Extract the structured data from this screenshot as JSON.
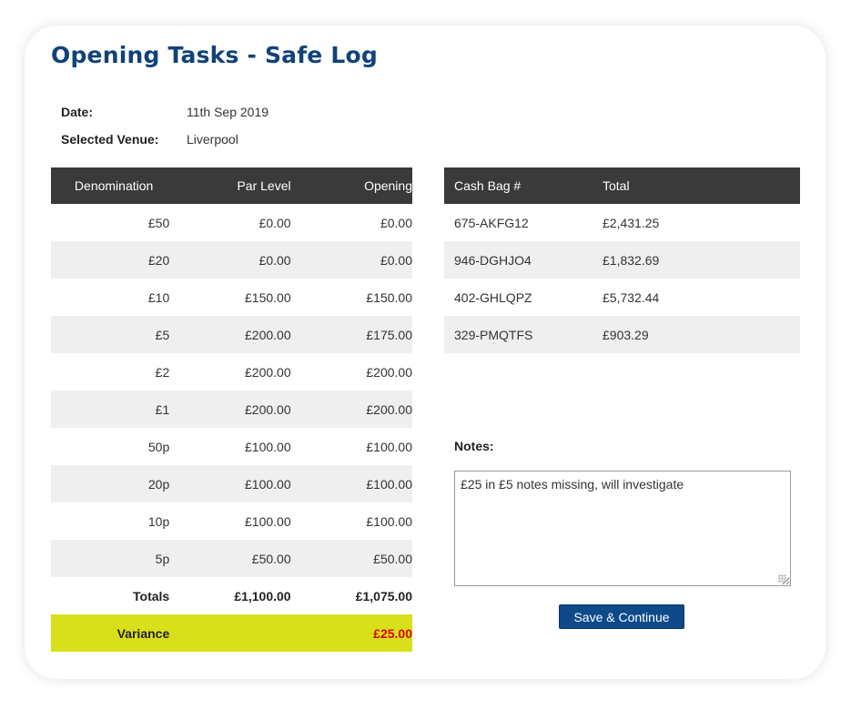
{
  "page": {
    "title": "Opening Tasks - Safe Log"
  },
  "meta": {
    "date_label": "Date:",
    "date_value": "11th Sep 2019",
    "venue_label": "Selected Venue:",
    "venue_value": "Liverpool"
  },
  "denominations": {
    "headers": [
      "Denomination",
      "Par Level",
      "Opening"
    ],
    "rows": [
      [
        "£50",
        "£0.00",
        "£0.00"
      ],
      [
        "£20",
        "£0.00",
        "£0.00"
      ],
      [
        "£10",
        "£150.00",
        "£150.00"
      ],
      [
        "£5",
        "£200.00",
        "£175.00"
      ],
      [
        "£2",
        "£200.00",
        "£200.00"
      ],
      [
        "£1",
        "£200.00",
        "£200.00"
      ],
      [
        "50p",
        "£100.00",
        "£100.00"
      ],
      [
        "20p",
        "£100.00",
        "£100.00"
      ],
      [
        "10p",
        "£100.00",
        "£100.00"
      ],
      [
        "5p",
        "£50.00",
        "£50.00"
      ]
    ],
    "totals": [
      "Totals",
      "£1,100.00",
      "£1,075.00"
    ],
    "variance": [
      "Variance",
      "",
      "£25.00"
    ]
  },
  "cash_bags": {
    "headers": [
      "Cash Bag #",
      "Total"
    ],
    "rows": [
      [
        "675-AKFG12",
        "£2,431.25"
      ],
      [
        "946-DGHJO4",
        "£1,832.69"
      ],
      [
        "402-GHLQPZ",
        "£5,732.44"
      ],
      [
        "329-PMQTFS",
        "£903.29"
      ]
    ]
  },
  "notes": {
    "label": "Notes:",
    "value": "£25 in £5 notes missing, will investigate"
  },
  "actions": {
    "save_label": "Save & Continue"
  },
  "colors": {
    "title": "#10427a",
    "header_bg": "#3a3a3a",
    "stripe": "#efefef",
    "variance_bg": "#d8e01c",
    "variance_negative": "#e00000",
    "button_bg": "#0e4a8a"
  }
}
